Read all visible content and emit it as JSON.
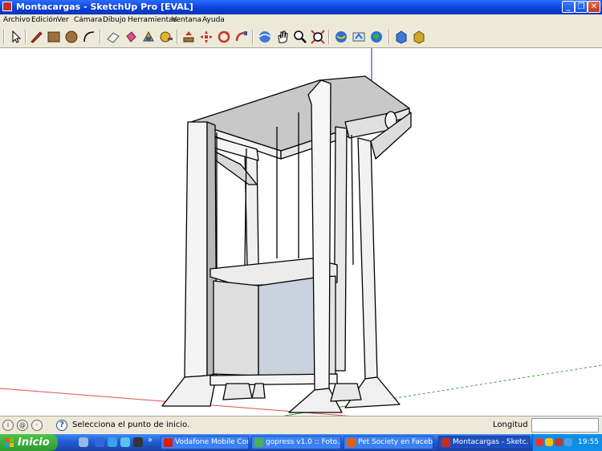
{
  "window": {
    "title": "Montacargas - SketchUp Pro [EVAL]"
  },
  "menu": [
    "Archivo",
    "Edición",
    "Ver",
    "Cámara",
    "Dibujo",
    "Herramientas",
    "Ventana",
    "Ayuda"
  ],
  "toolbar": {
    "tools": [
      "select-arrow-icon",
      "pencil-line-icon",
      "rectangle-icon",
      "circle-icon",
      "arc-icon",
      "eraser-icon",
      "paint-bucket-icon",
      "make-component-icon",
      "tape-measure-icon",
      "push-pull-icon",
      "move-icon",
      "rotate-icon",
      "follow-me-icon",
      "orbit-icon",
      "pan-icon",
      "zoom-icon",
      "zoom-extents-icon",
      "get-models-icon",
      "share-model-icon",
      "google-earth-icon",
      "component-store-icon"
    ]
  },
  "status": {
    "message": "Selecciona el punto de inicio.",
    "length_label": "Longitud",
    "length_value": ""
  },
  "taskbar": {
    "start_label": "Inicio",
    "more": "»",
    "buttons": [
      {
        "label": "Vodafone Mobile Con...",
        "icon": "vodafone-icon",
        "color": "#d81e05"
      },
      {
        "label": "gopress v1.0 :: Foto...",
        "icon": "chrome-icon",
        "color": "#4caf50"
      },
      {
        "label": "Pet Society en Faceb...",
        "icon": "firefox-icon",
        "color": "#e66000"
      },
      {
        "label": "Montacargas - Sketc...",
        "icon": "sketchup-icon",
        "color": "#c62d1f"
      }
    ],
    "clock": "19:55"
  }
}
